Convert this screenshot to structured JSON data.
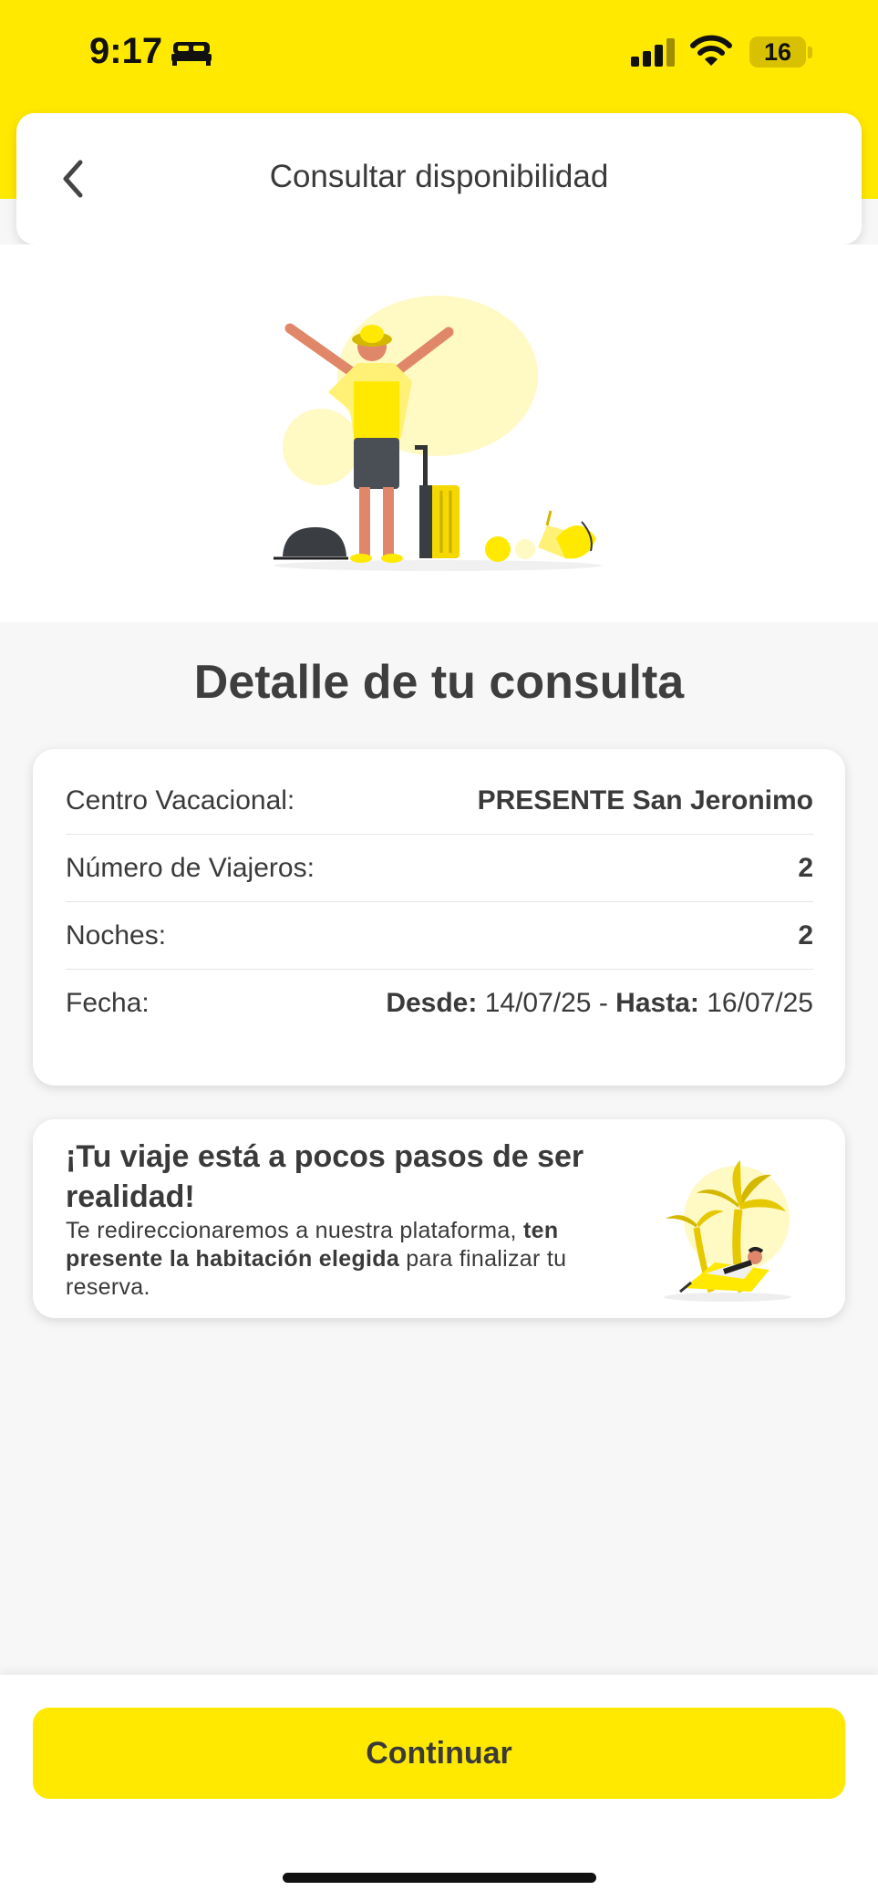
{
  "status_bar": {
    "time": "9:17",
    "battery": "16",
    "icons": [
      "sleep-bed-icon",
      "signal-icon",
      "wifi-icon",
      "battery-icon"
    ]
  },
  "header": {
    "title": "Consultar disponibilidad",
    "back_icon": "chevron-left-icon"
  },
  "hero": {
    "illustration": "traveler-with-luggage-illustration"
  },
  "detail": {
    "title": "Detalle de tu consulta",
    "rows": [
      {
        "label": "Centro Vacacional:",
        "value": "PRESENTE San Jeronimo"
      },
      {
        "label": "Número de Viajeros:",
        "value": "2"
      },
      {
        "label": "Noches:",
        "value": "2"
      }
    ],
    "date": {
      "label": "Fecha:",
      "from_label": "Desde:",
      "from_value": "14/07/25",
      "separator": "-",
      "to_label": "Hasta:",
      "to_value": "16/07/25"
    }
  },
  "promo": {
    "title": "¡Tu viaje está a pocos pasos de ser realidad!",
    "body_1": "Te redireccionaremos a nuestra plataforma, ",
    "body_bold": "ten presente la habitación elegida",
    "body_2": " para finalizar tu reserva.",
    "illustration": "palm-tree-beach-illustration"
  },
  "footer": {
    "continue_label": "Continuar"
  },
  "colors": {
    "accent_yellow": "#ffe900",
    "text_dark": "#3a3a3a",
    "background": "#f7f7f7"
  }
}
